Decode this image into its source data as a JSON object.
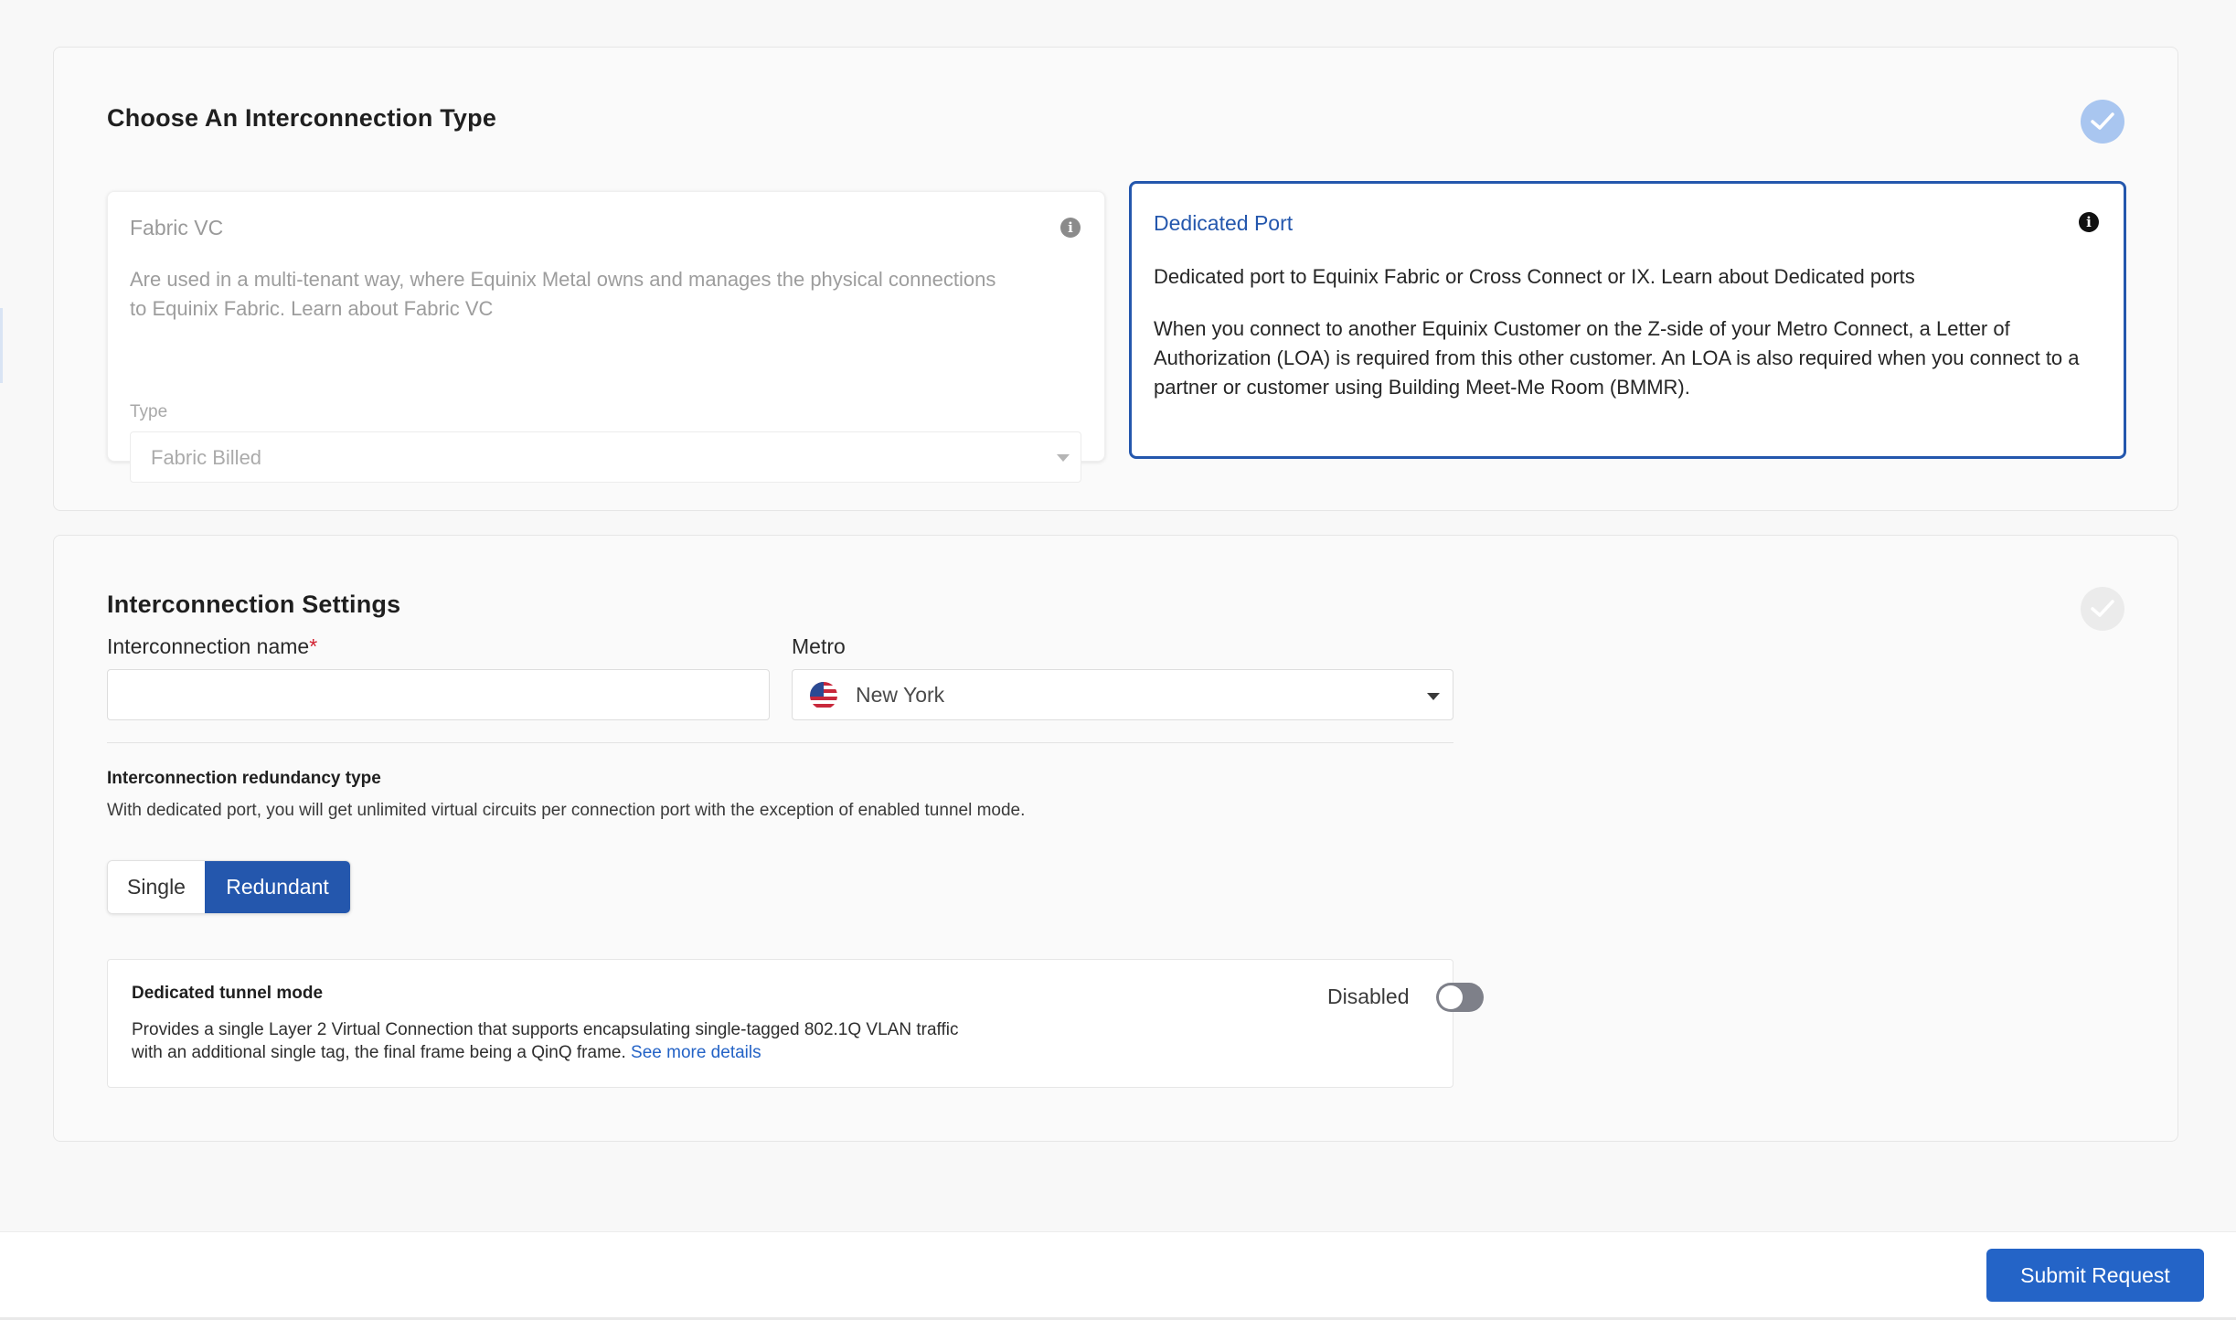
{
  "colors": {
    "accent": "#2457ad",
    "button": "#2464c7",
    "required": "#d11f2e",
    "link": "#2463c6"
  },
  "section1": {
    "title": "Choose An Interconnection Type",
    "status_icon": "check-circle-icon",
    "cards": {
      "fabric": {
        "title": "Fabric VC",
        "description": "Are used in a multi-tenant way, where Equinix Metal owns and manages the physical connections to Equinix Fabric. Learn about Fabric VC",
        "type_label": "Type",
        "type_value": "Fabric Billed",
        "selected": false
      },
      "dedicated": {
        "title": "Dedicated Port",
        "description": "Dedicated port to Equinix Fabric or Cross Connect or IX. Learn about Dedicated ports",
        "note": "When you connect to another Equinix Customer on the Z-side of your Metro Connect, a Letter of Authorization (LOA) is required from this other customer. An LOA is also required when you connect to a partner or customer using Building Meet-Me Room (BMMR).",
        "selected": true
      }
    }
  },
  "section2": {
    "title": "Interconnection Settings",
    "name_label": "Interconnection name",
    "required_mark": "*",
    "name_value": "",
    "metro_label": "Metro",
    "metro_value": "New York",
    "redundancy": {
      "title": "Interconnection redundancy type",
      "description": "With dedicated port, you will get unlimited virtual circuits per connection port with the exception of enabled tunnel mode.",
      "options": [
        "Single",
        "Redundant"
      ],
      "selected": "Redundant"
    },
    "tunnel": {
      "title": "Dedicated tunnel mode",
      "description": "Provides a single Layer 2 Virtual Connection that supports encapsulating single-tagged 802.1Q VLAN traffic with an additional single tag, the final frame being a QinQ frame.",
      "link": "See more details",
      "status": "Disabled",
      "enabled": false
    }
  },
  "footer": {
    "submit_label": "Submit Request"
  }
}
